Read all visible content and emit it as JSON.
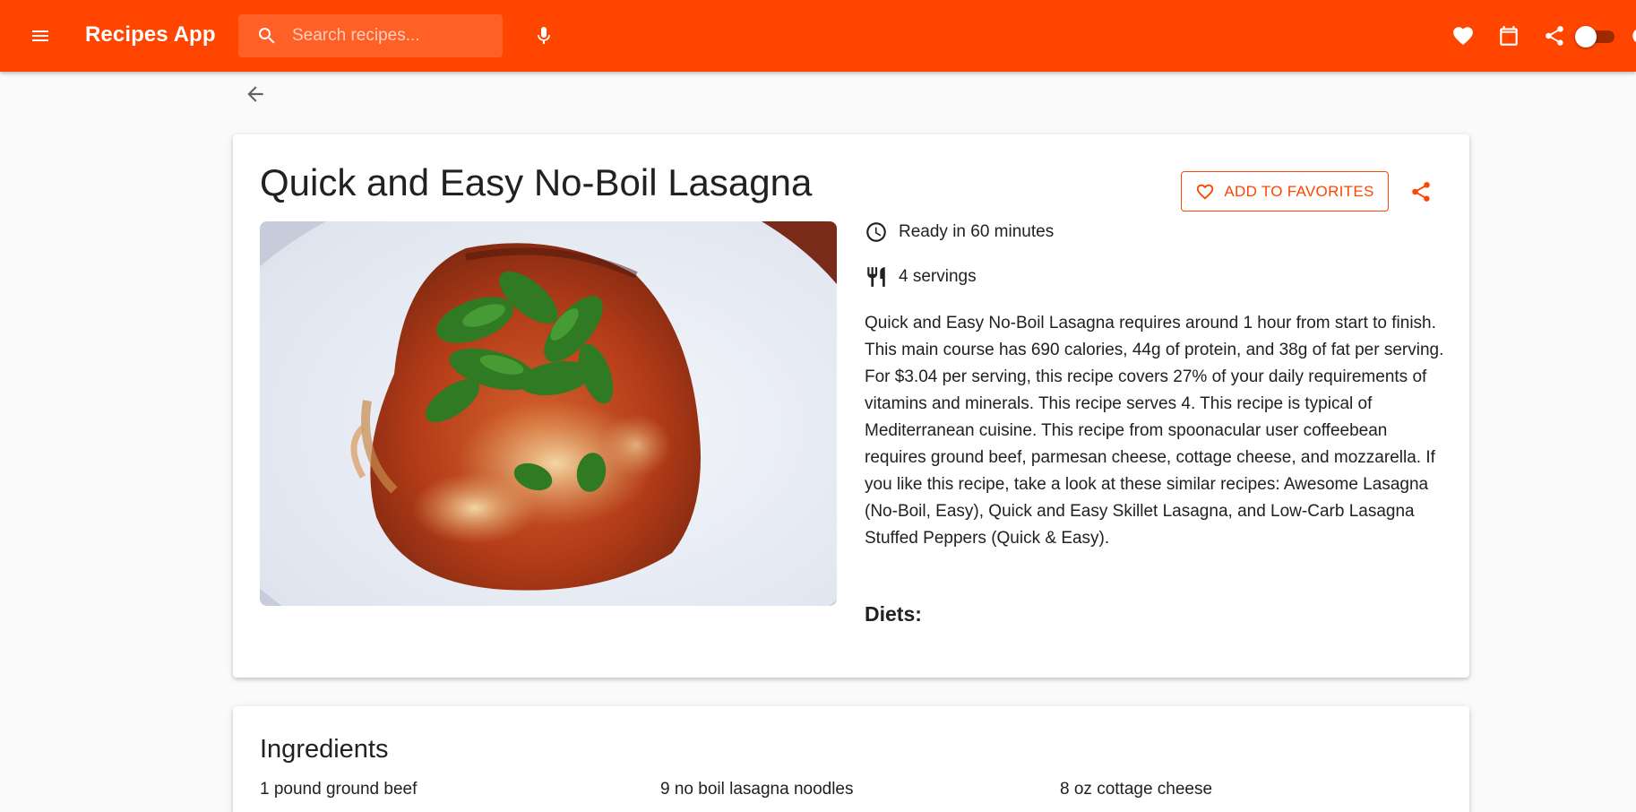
{
  "app": {
    "title": "Recipes App",
    "accent_color": "#ff4500",
    "search_placeholder": "Search recipes..."
  },
  "nav_icons": [
    "favorites-heart-icon",
    "calendar-icon",
    "share-icon"
  ],
  "recipe": {
    "title": "Quick and Easy No-Boil Lasagna",
    "favorite_label": "ADD TO FAVORITES",
    "ready_text": "Ready in 60 minutes",
    "servings_text": "4 servings",
    "description": "Quick and Easy No-Boil Lasagna requires around 1 hour from start to finish. This main course has 690 calories, 44g of protein, and 38g of fat per serving. For $3.04 per serving, this recipe covers 27% of your daily requirements of vitamins and minerals. This recipe serves 4. This recipe is typical of Mediterranean cuisine. This recipe from spoonacular user coffeebean requires ground beef, parmesan cheese, cottage cheese, and mozzarella. If you like this recipe, take a look at these similar recipes: Awesome Lasagna (No-Boil, Easy), Quick and Easy Skillet Lasagna, and Low-Carb Lasagna Stuffed Peppers (Quick & Easy).",
    "diets_label": "Diets:"
  },
  "ingredients": {
    "title": "Ingredients",
    "items": [
      "1 pound ground beef",
      "9 no boil lasagna noodles",
      "8 oz cottage cheese"
    ]
  }
}
